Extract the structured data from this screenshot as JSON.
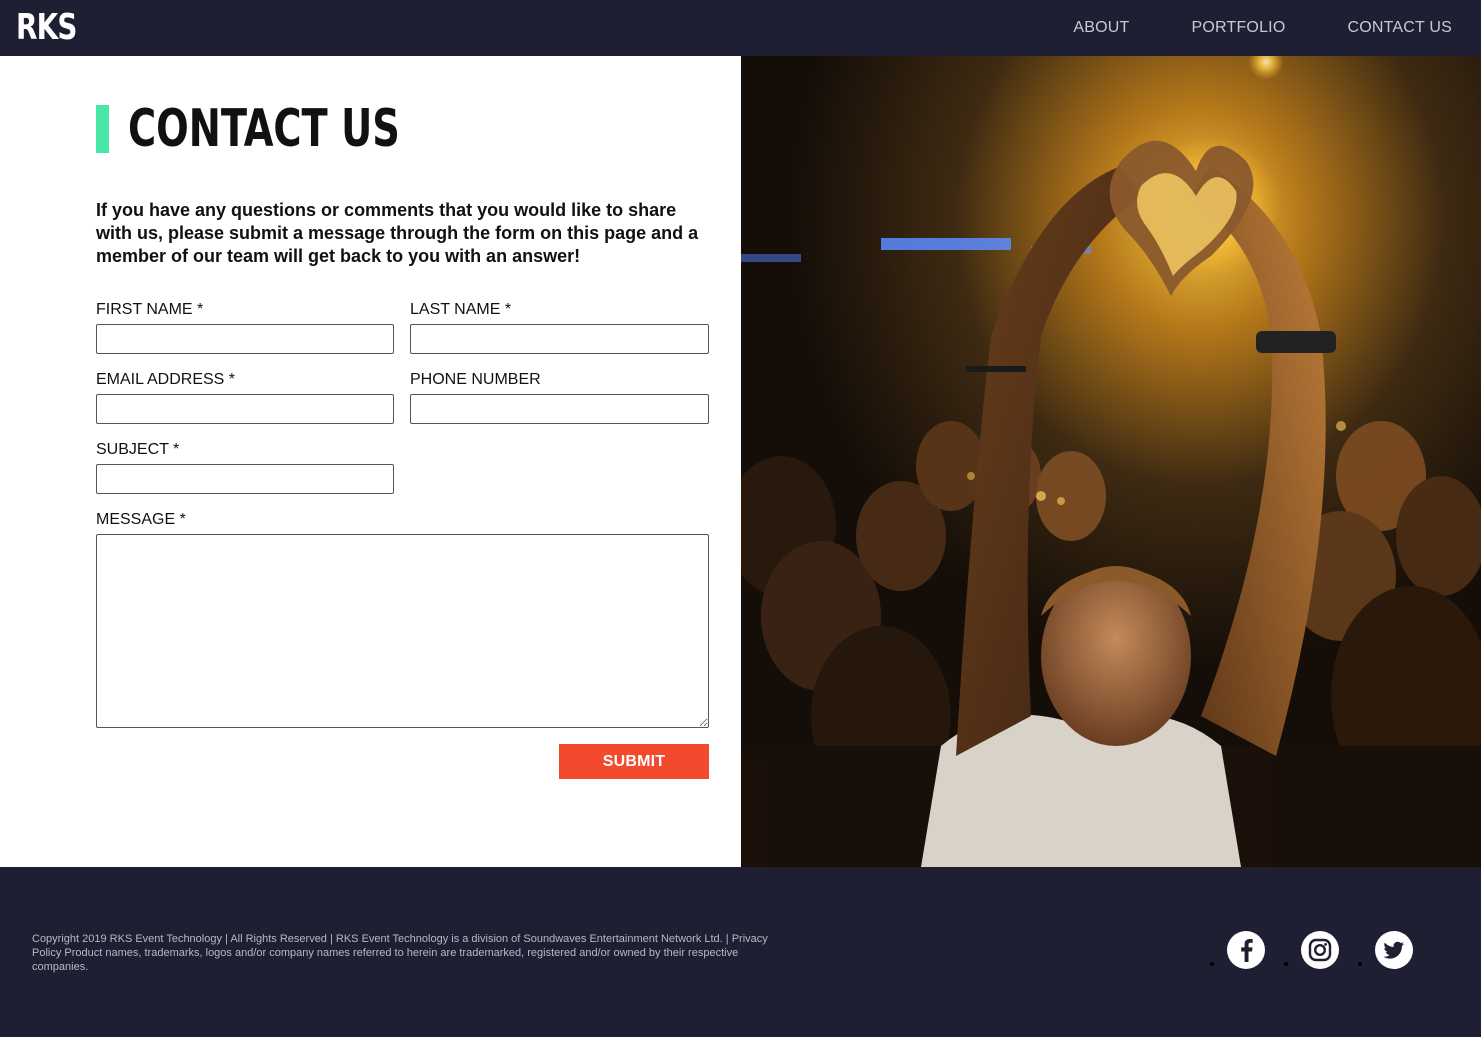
{
  "header": {
    "logo": "RKS",
    "nav": [
      {
        "label": "ABOUT"
      },
      {
        "label": "PORTFOLIO"
      },
      {
        "label": "CONTACT US"
      }
    ]
  },
  "main": {
    "title": "CONTACT US",
    "intro": "If you have any questions or comments that you would like to share with us, please submit a message through the form on this page and a member of our team will get back to you with an answer!",
    "form": {
      "first_name_label": "FIRST NAME *",
      "last_name_label": "LAST NAME *",
      "email_label": "EMAIL ADDRESS *",
      "phone_label": "PHONE NUMBER",
      "subject_label": "SUBJECT *",
      "message_label": "MESSAGE *",
      "first_name_value": "",
      "last_name_value": "",
      "email_value": "",
      "phone_value": "",
      "subject_value": "",
      "message_value": "",
      "submit_label": "SUBMIT"
    }
  },
  "footer": {
    "copyright": "Copyright 2019 RKS Event Technology | All Rights Reserved | RKS Event Technology is a division of Soundwaves Entertainment Network Ltd. | Privacy Policy Product names, trademarks, logos and/or company names referred to herein are trademarked, registered and/or owned by their respective companies.",
    "social": [
      {
        "icon": "facebook-icon"
      },
      {
        "icon": "instagram-icon"
      },
      {
        "icon": "twitter-icon"
      }
    ]
  },
  "colors": {
    "header_bg": "#1f1f33",
    "accent_green": "#48e5a6",
    "submit_red": "#f34a2e"
  }
}
